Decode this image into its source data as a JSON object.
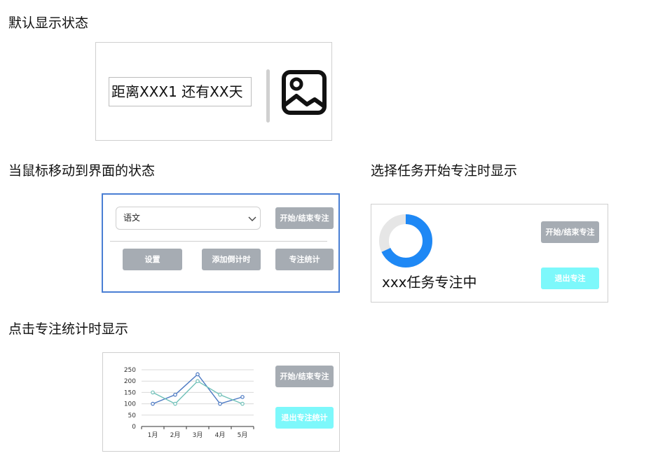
{
  "headings": {
    "default_state": "默认显示状态",
    "hover_state": "当鼠标移动到界面的状态",
    "focus_state": "选择任务开始专注时显示",
    "stats_state": "点击专注统计时显示"
  },
  "default_panel": {
    "countdown_text": "距离XXX1 还有XX天",
    "image_icon": "image-placeholder-icon"
  },
  "hover_panel": {
    "subject_select_value": "语文",
    "start_end_focus_label": "开始/结束专注",
    "settings_label": "设置",
    "add_countdown_label": "添加倒计时",
    "focus_stats_label": "专注统计"
  },
  "focus_panel": {
    "status_text": "xxx任务专注中",
    "start_end_focus_label": "开始/结束专注",
    "exit_focus_label": "退出专注",
    "progress_fraction": 0.68
  },
  "stats_panel": {
    "start_end_focus_label": "开始/结束专注",
    "exit_stats_label": "退出专注统计"
  },
  "colors": {
    "hover_border": "#4a7fd4",
    "gray_button": "#a6acb3",
    "cyan_button": "#7df8fb",
    "donut_progress": "#1e88f5",
    "donut_track": "#e6e6e6",
    "series_1": "#4a78c2",
    "series_2": "#6fc0b8"
  },
  "chart_data": {
    "type": "line",
    "categories": [
      "1月",
      "2月",
      "3月",
      "4月",
      "5月"
    ],
    "series": [
      {
        "values": [
          100,
          140,
          230,
          100,
          130
        ]
      },
      {
        "values": [
          150,
          100,
          200,
          140,
          100
        ]
      }
    ],
    "y_ticks": [
      "0",
      "50",
      "100",
      "150",
      "200",
      "250"
    ],
    "ylim": [
      0,
      250
    ],
    "grid": true,
    "title": "",
    "xlabel": "",
    "ylabel": ""
  }
}
